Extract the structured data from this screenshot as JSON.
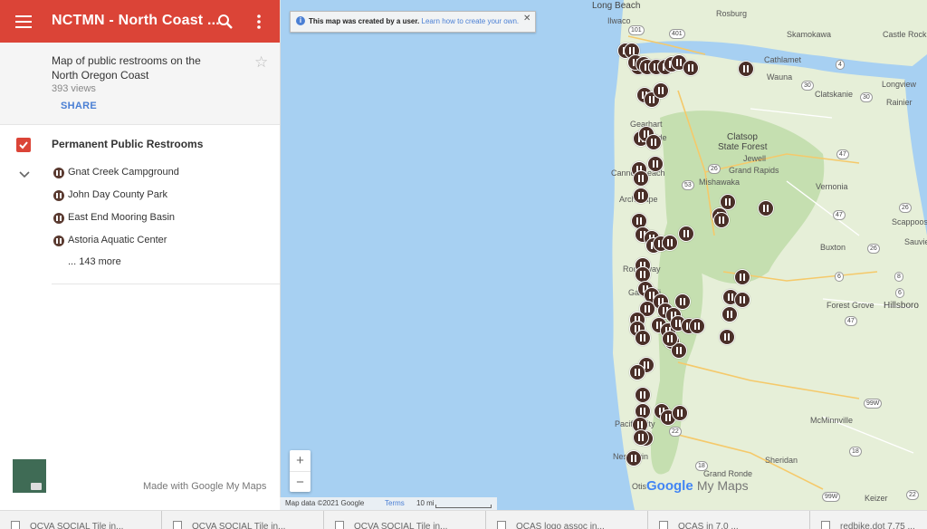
{
  "header": {
    "title": "NCTMN - North Coast ..."
  },
  "info": {
    "description": "Map of public restrooms on the North Oregon Coast",
    "views": "393 views",
    "share_label": "SHARE"
  },
  "layer": {
    "name": "Permanent Public Restrooms",
    "items": [
      {
        "label": "Gnat Creek Campground"
      },
      {
        "label": "John Day County Park"
      },
      {
        "label": "East End Mooring Basin"
      },
      {
        "label": "Astoria Aquatic Center"
      }
    ],
    "more_label": "... 143 more"
  },
  "footer": {
    "made_with": "Made with Google My Maps"
  },
  "banner": {
    "text": "This map was created by a user.",
    "link": "Learn how to create your own."
  },
  "zoom": {
    "in": "+",
    "out": "−"
  },
  "attribution": {
    "data": "Map data ©2021 Google",
    "terms": "Terms",
    "scale": "10 mi"
  },
  "logo": {
    "google": "Google",
    "suffix": "My Maps"
  },
  "map_labels": {
    "long_beach": "Long Beach",
    "ilwaco": "Ilwaco",
    "rosburg": "Rosburg",
    "skamokawa": "Skamokawa",
    "castle_rock": "Castle Rock",
    "cathlamet": "Cathlamet",
    "wauna": "Wauna",
    "clatskanie": "Clatskanie",
    "longview": "Longview",
    "rainier": "Rainier",
    "gearhart": "Gearhart",
    "seaside": "Seaside",
    "clatsop": "Clatsop",
    "state_forest": "State Forest",
    "jewell": "Jewell",
    "grand_rapids": "Grand Rapids",
    "cannon_beach": "Cannon Beach",
    "mishawaka": "Mishawaka",
    "vernonia": "Vernonia",
    "arch_cape": "Arch Cape",
    "scappoose": "Scappoose",
    "sauvie": "Sauvie",
    "buxton": "Buxton",
    "rockaway": "Rockaway",
    "garibaldi": "Garibaldi",
    "forest_grove": "Forest Grove",
    "hillsboro": "Hillsboro",
    "mcminnville": "McMinnville",
    "pacific_city": "Pacific City",
    "sheridan": "Sheridan",
    "neskowin": "Neskowin",
    "grand_ronde": "Grand Ronde",
    "otis": "Otis",
    "keizer": "Keizer"
  },
  "route_shields": [
    "101",
    "401",
    "4",
    "30",
    "30",
    "47",
    "26",
    "53",
    "47",
    "26",
    "26",
    "6",
    "6",
    "8",
    "47",
    "99W",
    "18",
    "22",
    "18",
    "99W",
    "22"
  ],
  "taskbar": {
    "tabs": [
      {
        "label": "OCVA SOCIAL Tile in..."
      },
      {
        "label": "OCVA SOCIAL Tile in..."
      },
      {
        "label": "OCVA SOCIAL Tile in..."
      },
      {
        "label": "OCAS logo assoc in..."
      },
      {
        "label": "OCAS in 7.0 ..."
      },
      {
        "label": "redbike.dot 7.75 ..."
      }
    ]
  },
  "colors": {
    "header": "#db4437",
    "water": "#a7d0f2",
    "land": "#e6efd8",
    "forest": "#c5dfb0",
    "marker": "#4a2f28",
    "link": "#4a7fd4"
  }
}
